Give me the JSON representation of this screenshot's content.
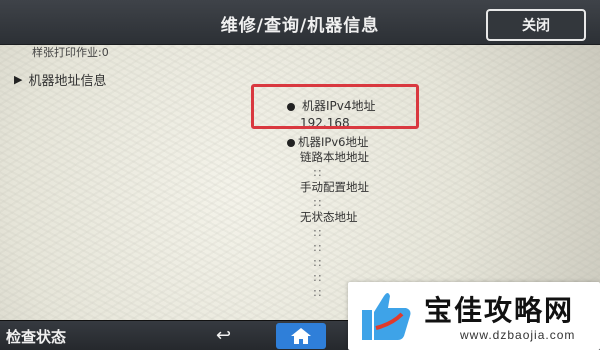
{
  "header": {
    "title": "维修/查询/机器信息",
    "close_label": "关闭"
  },
  "content": {
    "sample_print_jobs": "样张打印作业:0",
    "section": {
      "label": "机器地址信息"
    },
    "ipv4": {
      "label": "机器IPv4地址",
      "value": "192.168"
    },
    "ipv6": {
      "label": "机器IPv6地址",
      "link_local_label": "链路本地地址",
      "manual_label": "手动配置地址",
      "stateless_label": "无状态地址",
      "colon_placeholder": "::"
    }
  },
  "footer": {
    "status_label": "检查状态",
    "back_icon": "back-arrow-icon",
    "home_icon": "home-icon",
    "home_color": "#2f7fd9"
  },
  "watermark_badge": {
    "title": "宝佳攻略网",
    "url": "www.dzbaojia.com",
    "accent": "#e03a2b"
  },
  "highlight_color": "#d9383f"
}
